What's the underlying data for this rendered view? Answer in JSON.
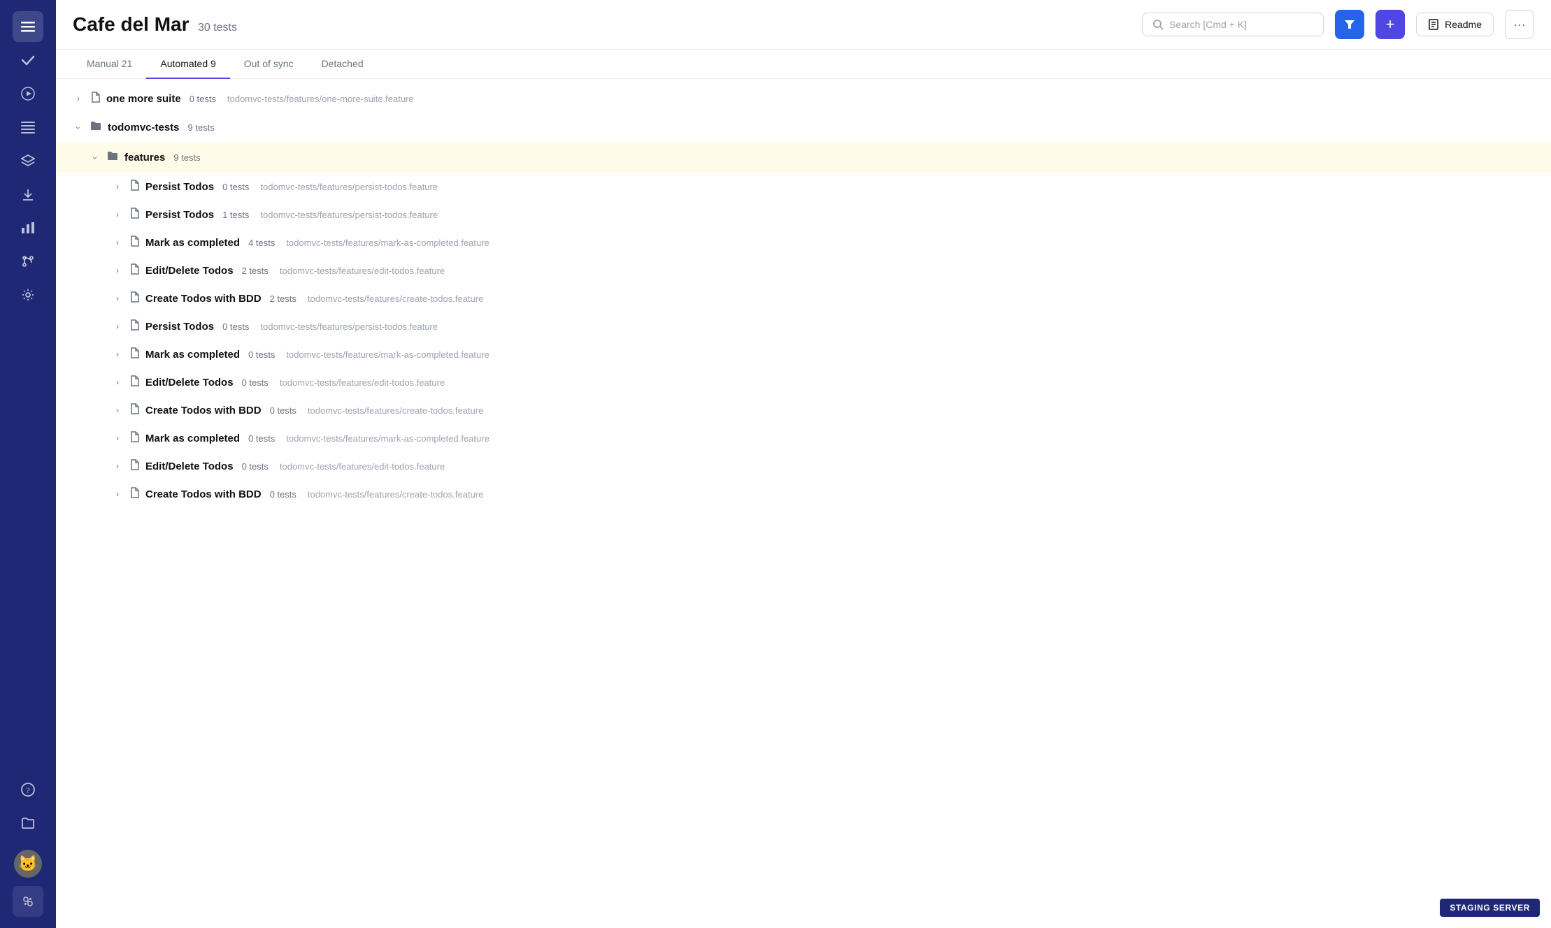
{
  "app": {
    "title": "Cafe del Mar",
    "test_count": "30 tests",
    "staging_badge": "STAGING SERVER"
  },
  "header": {
    "search_placeholder": "Search [Cmd + K]",
    "readme_label": "Readme",
    "add_label": "+",
    "filter_label": "Filter",
    "more_label": "···"
  },
  "tabs": [
    {
      "id": "manual",
      "label": "Manual 21"
    },
    {
      "id": "automated",
      "label": "Automated 9"
    },
    {
      "id": "out-of-sync",
      "label": "Out of sync"
    },
    {
      "id": "detached",
      "label": "Detached"
    }
  ],
  "sidebar": {
    "icons": [
      {
        "id": "menu",
        "symbol": "☰"
      },
      {
        "id": "check",
        "symbol": "✓"
      },
      {
        "id": "play",
        "symbol": "▶"
      },
      {
        "id": "list",
        "symbol": "≡"
      },
      {
        "id": "layers",
        "symbol": "◈"
      },
      {
        "id": "import",
        "symbol": "⬆"
      },
      {
        "id": "chart",
        "symbol": "▦"
      },
      {
        "id": "git",
        "symbol": "⑂"
      },
      {
        "id": "gear",
        "symbol": "⚙"
      },
      {
        "id": "help",
        "symbol": "?"
      },
      {
        "id": "folder",
        "symbol": "🗂"
      }
    ]
  },
  "suites": [
    {
      "id": "one-more-suite",
      "type": "file",
      "level": 0,
      "expanded": false,
      "name": "one more suite",
      "count": "0 tests",
      "path": "todomvc-tests/features/one-more-suite.feature",
      "highlighted": false
    },
    {
      "id": "todomvc-tests",
      "type": "folder",
      "level": 0,
      "expanded": true,
      "name": "todomvc-tests",
      "count": "9 tests",
      "path": "",
      "highlighted": false
    },
    {
      "id": "features",
      "type": "folder",
      "level": 1,
      "expanded": true,
      "name": "features",
      "count": "9 tests",
      "path": "",
      "highlighted": true
    },
    {
      "id": "persist-todos-1",
      "type": "file",
      "level": 2,
      "expanded": false,
      "name": "Persist Todos",
      "count": "0 tests",
      "path": "todomvc-tests/features/persist-todos.feature",
      "highlighted": false
    },
    {
      "id": "persist-todos-2",
      "type": "file",
      "level": 2,
      "expanded": false,
      "name": "Persist Todos",
      "count": "1 tests",
      "path": "todomvc-tests/features/persist-todos.feature",
      "highlighted": false
    },
    {
      "id": "mark-as-completed-1",
      "type": "file",
      "level": 2,
      "expanded": false,
      "name": "Mark as completed",
      "count": "4 tests",
      "path": "todomvc-tests/features/mark-as-completed.feature",
      "highlighted": false
    },
    {
      "id": "edit-delete-todos-1",
      "type": "file",
      "level": 2,
      "expanded": false,
      "name": "Edit/Delete Todos",
      "count": "2 tests",
      "path": "todomvc-tests/features/edit-todos.feature",
      "highlighted": false
    },
    {
      "id": "create-todos-bdd-1",
      "type": "file",
      "level": 2,
      "expanded": false,
      "name": "Create Todos with BDD",
      "count": "2 tests",
      "path": "todomvc-tests/features/create-todos.feature",
      "highlighted": false
    },
    {
      "id": "persist-todos-3",
      "type": "file",
      "level": 2,
      "expanded": false,
      "name": "Persist Todos",
      "count": "0 tests",
      "path": "todomvc-tests/features/persist-todos.feature",
      "highlighted": false
    },
    {
      "id": "mark-as-completed-2",
      "type": "file",
      "level": 2,
      "expanded": false,
      "name": "Mark as completed",
      "count": "0 tests",
      "path": "todomvc-tests/features/mark-as-completed.feature",
      "highlighted": false
    },
    {
      "id": "edit-delete-todos-2",
      "type": "file",
      "level": 2,
      "expanded": false,
      "name": "Edit/Delete Todos",
      "count": "0 tests",
      "path": "todomvc-tests/features/edit-todos.feature",
      "highlighted": false
    },
    {
      "id": "create-todos-bdd-2",
      "type": "file",
      "level": 2,
      "expanded": false,
      "name": "Create Todos with BDD",
      "count": "0 tests",
      "path": "todomvc-tests/features/create-todos.feature",
      "highlighted": false
    },
    {
      "id": "mark-as-completed-3",
      "type": "file",
      "level": 2,
      "expanded": false,
      "name": "Mark as completed",
      "count": "0 tests",
      "path": "todomvc-tests/features/mark-as-completed.feature",
      "highlighted": false
    },
    {
      "id": "edit-delete-todos-3",
      "type": "file",
      "level": 2,
      "expanded": false,
      "name": "Edit/Delete Todos",
      "count": "0 tests",
      "path": "todomvc-tests/features/edit-todos.feature",
      "highlighted": false
    },
    {
      "id": "create-todos-bdd-3",
      "type": "file",
      "level": 2,
      "expanded": false,
      "name": "Create Todos with BDD",
      "count": "0 tests",
      "path": "todomvc-tests/features/create-todos.feature",
      "highlighted": false
    }
  ]
}
